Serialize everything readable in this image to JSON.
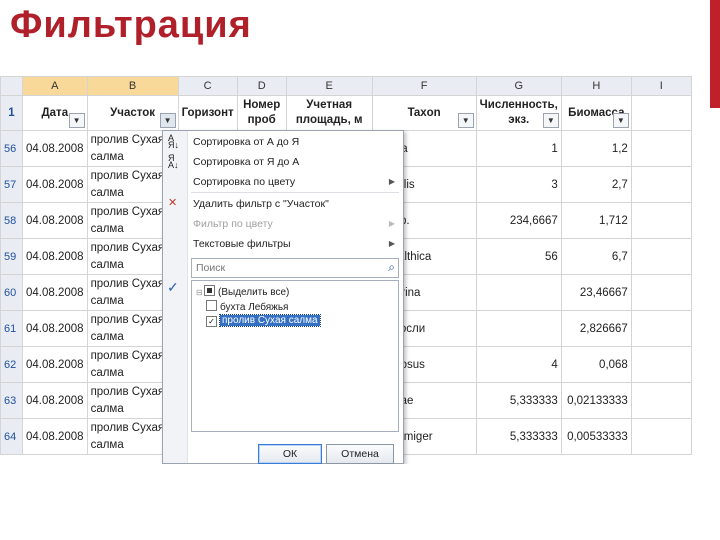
{
  "slide": {
    "title": "Фильтрация",
    "accent_color": "#c0202c",
    "title_color": "#b0202a"
  },
  "sheet": {
    "columns": [
      "A",
      "B",
      "C",
      "D",
      "E",
      "F",
      "G",
      "H",
      "I"
    ],
    "header_row_num": "1",
    "headers": {
      "date": "Дата",
      "site": "Участок",
      "horizon": "Горизонт",
      "sample": "Номер проб",
      "area": "Учетная площадь, м",
      "taxon": "Taxon",
      "abundance": "Численность, экз.",
      "biomass": "Биомасса"
    },
    "rows": [
      {
        "n": "56",
        "date": "04.08.2008",
        "site": "пролив Сухая салма",
        "taxon": "enaria",
        "abundance": "1",
        "biomass": "1,2"
      },
      {
        "n": "57",
        "date": "04.08.2008",
        "site": "пролив Сухая салма",
        "taxon": "s edulis",
        "abundance": "3",
        "biomass": "2,7"
      },
      {
        "n": "58",
        "date": "04.08.2008",
        "site": "пролив Сухая салма",
        "taxon": "oia sp.",
        "abundance": "234,6667",
        "biomass": "1,712"
      },
      {
        "n": "59",
        "date": "04.08.2008",
        "site": "пролив Сухая салма",
        "taxon": "na balthica",
        "abundance": "56",
        "biomass": "6,7"
      },
      {
        "n": "60",
        "date": "04.08.2008",
        "site": "пролив Сухая салма",
        "taxon": "a marina",
        "abundance": "",
        "biomass": "23,46667"
      },
      {
        "n": "61",
        "date": "04.08.2008",
        "site": "пролив Сухая салма",
        "taxon": "ные осли",
        "abundance": "",
        "biomass": "2,826667"
      },
      {
        "n": "62",
        "date": "04.08.2008",
        "site": "пролив Сухая салма",
        "taxon": "otus osus",
        "abundance": "4",
        "biomass": "0,068"
      },
      {
        "n": "63",
        "date": "04.08.2008",
        "site": "пролив Сухая салма",
        "taxon": "omidae",
        "abundance": "5,333333",
        "biomass": "0,02133333"
      },
      {
        "n": "64",
        "date": "04.08.2008",
        "site": "пролив Сухая салма",
        "taxon": "los armiger",
        "abundance": "5,333333",
        "biomass": "0,00533333"
      }
    ]
  },
  "filter_menu": {
    "sort_asc": "Сортировка от А до Я",
    "sort_desc": "Сортировка от Я до А",
    "sort_color": "Сортировка по цвету",
    "clear_filter": "Удалить фильтр с \"Участок\"",
    "filter_color": "Фильтр по цвету",
    "text_filters": "Текстовые фильтры",
    "search_placeholder": "Поиск",
    "items": [
      {
        "label": "(Выделить все)",
        "state": "partial"
      },
      {
        "label": "бухта Лебяжья",
        "state": "unchecked"
      },
      {
        "label": "пролив Сухая салма",
        "state": "checked"
      }
    ],
    "ok": "ОК",
    "cancel": "Отмена"
  }
}
